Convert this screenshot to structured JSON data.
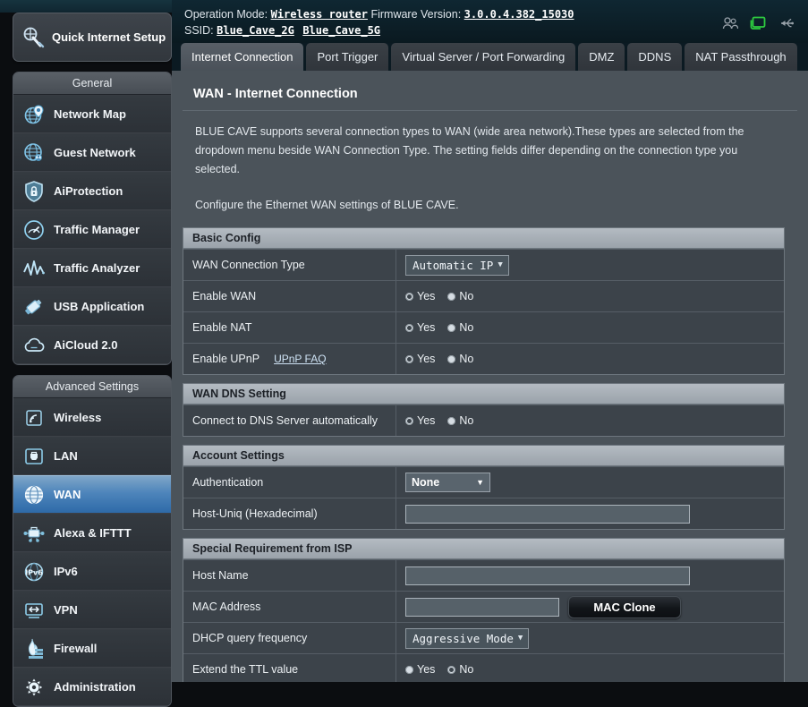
{
  "status": {
    "operation_mode_label": "Operation Mode:",
    "operation_mode_value": "Wireless router",
    "firmware_label": "Firmware Version:",
    "firmware_value": "3.0.0.4.382_15030",
    "ssid_label": "SSID:",
    "ssid_2g": "Blue_Cave_2G",
    "ssid_5g": "Blue_Cave_5G",
    "icons": [
      "clients-icon",
      "display-icon",
      "usb-icon"
    ],
    "display_icon_color": "#2ecc40"
  },
  "tabs": [
    {
      "label": "Internet Connection",
      "active": true
    },
    {
      "label": "Port Trigger",
      "active": false
    },
    {
      "label": "Virtual Server / Port Forwarding",
      "active": false
    },
    {
      "label": "DMZ",
      "active": false
    },
    {
      "label": "DDNS",
      "active": false
    },
    {
      "label": "NAT Passthrough",
      "active": false
    }
  ],
  "sidebar": {
    "quick_setup": "Quick Internet Setup",
    "general_label": "General",
    "general_items": [
      {
        "label": "Network Map",
        "icon": "network-map-icon"
      },
      {
        "label": "Guest Network",
        "icon": "guest-network-icon"
      },
      {
        "label": "AiProtection",
        "icon": "shield-lock-icon"
      },
      {
        "label": "Traffic Manager",
        "icon": "gauge-icon"
      },
      {
        "label": "Traffic Analyzer",
        "icon": "waveform-icon"
      },
      {
        "label": "USB Application",
        "icon": "usb-stick-icon"
      },
      {
        "label": "AiCloud 2.0",
        "icon": "cloud-icon"
      }
    ],
    "advanced_label": "Advanced Settings",
    "advanced_items": [
      {
        "label": "Wireless",
        "icon": "wifi-icon",
        "selected": false
      },
      {
        "label": "LAN",
        "icon": "lan-port-icon",
        "selected": false
      },
      {
        "label": "WAN",
        "icon": "globe-icon",
        "selected": true
      },
      {
        "label": "Alexa & IFTTT",
        "icon": "alexa-ifttt-icon",
        "selected": false
      },
      {
        "label": "IPv6",
        "icon": "ipv6-icon",
        "selected": false
      },
      {
        "label": "VPN",
        "icon": "vpn-monitor-icon",
        "selected": false
      },
      {
        "label": "Firewall",
        "icon": "firewall-flame-icon",
        "selected": false
      },
      {
        "label": "Administration",
        "icon": "gear-icon",
        "selected": false
      }
    ]
  },
  "page": {
    "title": "WAN - Internet Connection",
    "desc_1": "BLUE CAVE supports several connection types to WAN (wide area network).These types are selected from the dropdown menu beside WAN Connection Type. The setting fields differ depending on the connection type you selected.",
    "desc_2": "Configure the Ethernet WAN settings of BLUE CAVE."
  },
  "basic_config": {
    "heading": "Basic Config",
    "wan_connection_type_label": "WAN Connection Type",
    "wan_connection_type_value": "Automatic IP",
    "enable_wan_label": "Enable WAN",
    "enable_wan_value": "Yes",
    "enable_nat_label": "Enable NAT",
    "enable_nat_value": "Yes",
    "enable_upnp_label": "Enable UPnP",
    "enable_upnp_faq": "UPnP FAQ",
    "enable_upnp_value": "Yes",
    "yes_label": "Yes",
    "no_label": "No"
  },
  "wan_dns": {
    "heading": "WAN DNS Setting",
    "connect_dns_label": "Connect to DNS Server automatically",
    "connect_dns_value": "Yes"
  },
  "account_settings": {
    "heading": "Account Settings",
    "authentication_label": "Authentication",
    "authentication_value": "None",
    "host_uniq_label": "Host-Uniq (Hexadecimal)",
    "host_uniq_value": ""
  },
  "special_isp": {
    "heading": "Special Requirement from ISP",
    "host_name_label": "Host Name",
    "host_name_value": "",
    "mac_address_label": "MAC Address",
    "mac_address_value": "",
    "mac_clone_button": "MAC Clone",
    "dhcp_query_label": "DHCP query frequency",
    "dhcp_query_value": "Aggressive Mode",
    "extend_ttl_label": "Extend the TTL value",
    "extend_ttl_value": "No"
  },
  "theme": {
    "accent_blue": "#2e6aa8",
    "panel_bg": "#4b535a",
    "row_bg": "#3c434a",
    "section_head": "#a8b0b8"
  }
}
